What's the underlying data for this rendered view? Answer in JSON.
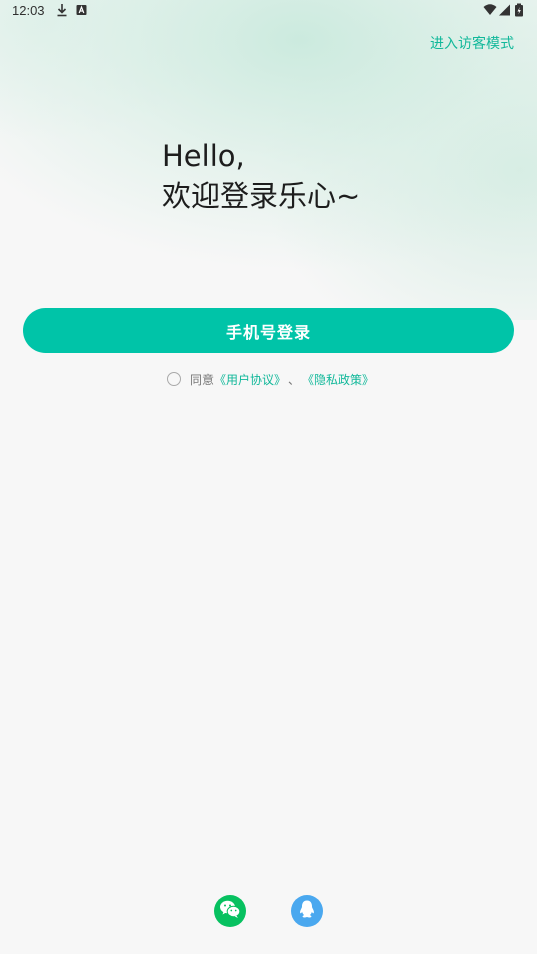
{
  "status_bar": {
    "time": "12:03",
    "icons": [
      "download-icon",
      "keyboard-a-icon",
      "wifi-icon",
      "signal-icon",
      "battery-icon"
    ]
  },
  "header": {
    "guest_mode_label": "进入访客模式"
  },
  "greeting": {
    "line1": "Hello,",
    "line2": "欢迎登录乐心~"
  },
  "login": {
    "phone_login_label": "手机号登录"
  },
  "agreement": {
    "prefix": "同意",
    "user_agreement": "《用户协议》",
    "separator": "、",
    "privacy_policy": "《隐私政策》"
  },
  "social": {
    "icons": [
      "wechat-icon",
      "qq-icon"
    ]
  },
  "colors": {
    "accent": "#00c4a8",
    "link": "#11b89a",
    "wechat": "#07c160",
    "qq": "#4aa8ef",
    "background": "#f7f7f7"
  }
}
